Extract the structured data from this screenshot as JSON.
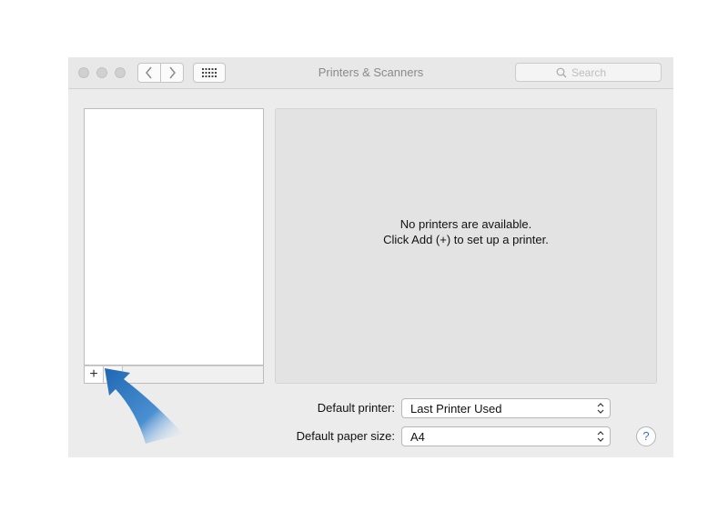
{
  "window": {
    "title": "Printers & Scanners",
    "search": {
      "placeholder": "Search"
    }
  },
  "toolbar": {
    "traffic_lights": [
      "close",
      "minimize",
      "zoom"
    ],
    "back_icon": "chevron-left-icon",
    "forward_icon": "chevron-right-icon",
    "show_all_icon": "grid-icon"
  },
  "printer_list": {
    "items": [],
    "add_label": "+"
  },
  "details": {
    "line1": "No printers are available.",
    "line2": "Click Add (+) to set up a printer."
  },
  "settings": {
    "default_printer_label": "Default printer:",
    "default_printer_value": "Last Printer Used",
    "paper_size_label": "Default paper size:",
    "paper_size_value": "A4"
  },
  "help": {
    "label": "?"
  },
  "colors": {
    "arrow": "#1f68b3",
    "help_glyph": "#3b6fd6"
  }
}
